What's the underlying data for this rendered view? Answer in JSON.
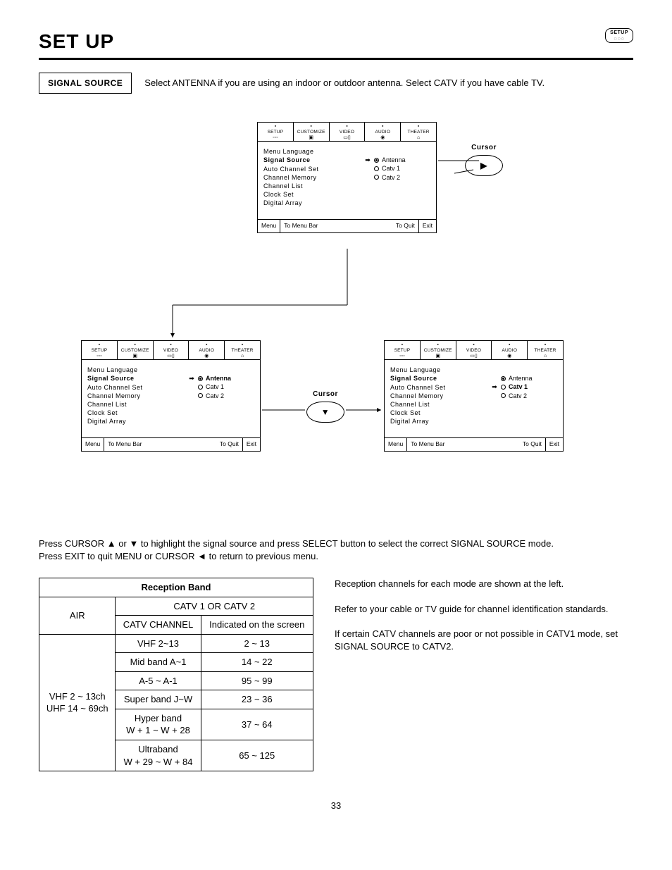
{
  "page_title": "SET UP",
  "setup_badge_label": "SETUP",
  "section_label": "SIGNAL SOURCE",
  "section_desc": "Select ANTENNA if you are using an indoor or outdoor antenna.  Select CATV if you have cable TV.",
  "osd_tabs": [
    "SETUP",
    "CUSTOMIZE",
    "VIDEO",
    "AUDIO",
    "THEATER"
  ],
  "osd_tab_icons": [
    "◦◦◦",
    "▣",
    "▭▯",
    "◉",
    "⌂"
  ],
  "menu_items": {
    "0": "Menu Language",
    "1": "Signal Source",
    "2": "Auto Channel Set",
    "3": "Channel Memory",
    "4": "Channel List",
    "5": "Clock Set",
    "6": "Digital Array"
  },
  "options": {
    "antenna": "Antenna",
    "catv1": "Catv 1",
    "catv2": "Catv 2"
  },
  "footer": {
    "menu": "Menu",
    "to_menu_bar": "To Menu Bar",
    "to_quit": "To Quit",
    "exit": "Exit"
  },
  "cursor_label": "Cursor",
  "instructions_1": "Press CURSOR ▲ or ▼ to highlight the signal source and press SELECT button to select the correct SIGNAL SOURCE mode.",
  "instructions_2": "Press EXIT to quit MENU or CURSOR ◄ to return to previous menu.",
  "table_title": "Reception Band",
  "table": {
    "col_catv_group": "CATV 1 OR CATV 2",
    "col_air": "AIR",
    "col_catv_channel": "CATV CHANNEL",
    "col_indicated": "Indicated on the screen",
    "air_cell_1": "VHF 2 ~ 13ch",
    "air_cell_2": "UHF 14 ~ 69ch",
    "rows": [
      {
        "catv": "VHF 2~13",
        "ind": "2 ~ 13"
      },
      {
        "catv": "Mid band A~1",
        "ind": "14 ~ 22"
      },
      {
        "catv": "A-5 ~ A-1",
        "ind": "95 ~ 99"
      },
      {
        "catv": "Super band J~W",
        "ind": "23 ~ 36"
      },
      {
        "catv": "Hyper band\nW + 1 ~ W + 28",
        "ind": "37 ~ 64"
      },
      {
        "catv": "Ultraband\nW + 29 ~ W + 84",
        "ind": "65 ~ 125"
      }
    ]
  },
  "right_para_1": "Reception channels for each mode are shown at the left.",
  "right_para_2": "Refer to your cable or TV guide for channel identification standards.",
  "right_para_3": "If certain CATV channels are poor or not possible in CATV1 mode, set SIGNAL SOURCE to CATV2.",
  "page_number": "33"
}
